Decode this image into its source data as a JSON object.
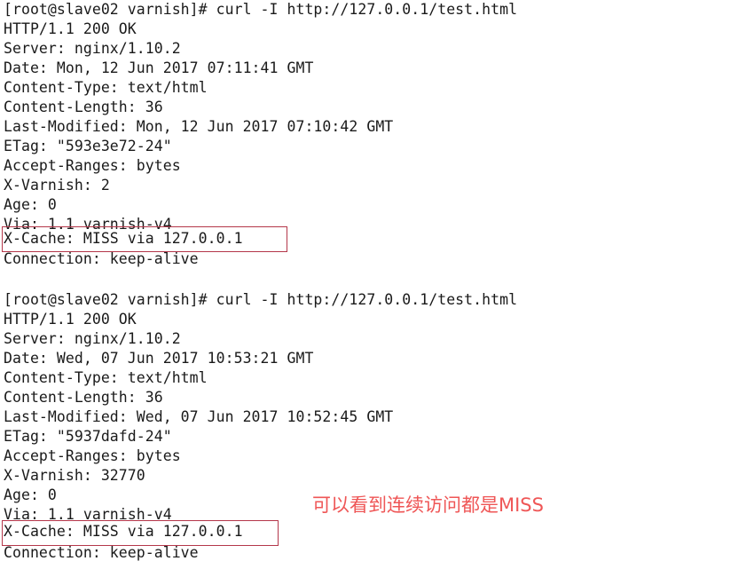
{
  "terminal": {
    "background_color": "#ffffff",
    "text_color": "#1a1a1a",
    "highlight_color": "#b4374a",
    "annotation_color": "#ef5656",
    "prompt": "[root@slave02 varnish]#",
    "lines": [
      {
        "id": "l0",
        "text": "[root@slave02 varnish]# curl -I http://127.0.0.1/test.html",
        "kind": "command"
      },
      {
        "id": "l1",
        "text": "HTTP/1.1 200 OK",
        "kind": "output"
      },
      {
        "id": "l2",
        "text": "Server: nginx/1.10.2",
        "kind": "output"
      },
      {
        "id": "l3",
        "text": "Date: Mon, 12 Jun 2017 07:11:41 GMT",
        "kind": "output"
      },
      {
        "id": "l4",
        "text": "Content-Type: text/html",
        "kind": "output"
      },
      {
        "id": "l5",
        "text": "Content-Length: 36",
        "kind": "output"
      },
      {
        "id": "l6",
        "text": "Last-Modified: Mon, 12 Jun 2017 07:10:42 GMT",
        "kind": "output"
      },
      {
        "id": "l7",
        "text": "ETag: \"593e3e72-24\"",
        "kind": "output"
      },
      {
        "id": "l8",
        "text": "Accept-Ranges: bytes",
        "kind": "output"
      },
      {
        "id": "l9",
        "text": "X-Varnish: 2",
        "kind": "output"
      },
      {
        "id": "l10",
        "text": "Age: 0",
        "kind": "output"
      },
      {
        "id": "l11",
        "text": "Via: 1.1 varnish-v4",
        "kind": "output"
      },
      {
        "id": "l12",
        "text": "X-Cache: MISS via 127.0.0.1",
        "kind": "output-highlighted"
      },
      {
        "id": "l13",
        "text": "Connection: keep-alive",
        "kind": "output"
      },
      {
        "id": "l14",
        "text": "",
        "kind": "blank"
      },
      {
        "id": "l15",
        "text": "[root@slave02 varnish]# curl -I http://127.0.0.1/test.html",
        "kind": "command"
      },
      {
        "id": "l16",
        "text": "HTTP/1.1 200 OK",
        "kind": "output"
      },
      {
        "id": "l17",
        "text": "Server: nginx/1.10.2",
        "kind": "output"
      },
      {
        "id": "l18",
        "text": "Date: Wed, 07 Jun 2017 10:53:21 GMT",
        "kind": "output"
      },
      {
        "id": "l19",
        "text": "Content-Type: text/html",
        "kind": "output"
      },
      {
        "id": "l20",
        "text": "Content-Length: 36",
        "kind": "output"
      },
      {
        "id": "l21",
        "text": "Last-Modified: Wed, 07 Jun 2017 10:52:45 GMT",
        "kind": "output"
      },
      {
        "id": "l22",
        "text": "ETag: \"5937dafd-24\"",
        "kind": "output"
      },
      {
        "id": "l23",
        "text": "Accept-Ranges: bytes",
        "kind": "output"
      },
      {
        "id": "l24",
        "text": "X-Varnish: 32770",
        "kind": "output"
      },
      {
        "id": "l25",
        "text": "Age: 0",
        "kind": "output"
      },
      {
        "id": "l26",
        "text": "Via: 1.1 varnish-v4",
        "kind": "output"
      },
      {
        "id": "l27",
        "text": "X-Cache: MISS via 127.0.0.1",
        "kind": "output-highlighted"
      },
      {
        "id": "l28",
        "text": "Connection: keep-alive",
        "kind": "output"
      }
    ],
    "highlights": [
      {
        "id": "h0",
        "target_line": "l12",
        "label": "x-cache-miss-highlight-1"
      },
      {
        "id": "h1",
        "target_line": "l27",
        "label": "x-cache-miss-highlight-2"
      }
    ],
    "annotations": [
      {
        "id": "a0",
        "text": "可以看到连续访问都是MISS"
      }
    ]
  }
}
